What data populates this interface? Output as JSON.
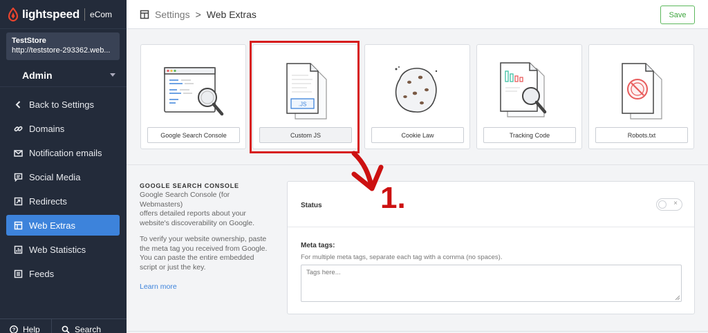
{
  "brand": {
    "name": "lightspeed",
    "product": "eCom"
  },
  "store": {
    "name": "TestStore",
    "url": "http://teststore-293362.web..."
  },
  "user_menu": {
    "label": "Admin"
  },
  "nav": [
    {
      "label": "Back to Settings",
      "icon": "chevron-left-icon",
      "active": false
    },
    {
      "label": "Domains",
      "icon": "link-icon",
      "active": false
    },
    {
      "label": "Notification emails",
      "icon": "email-icon",
      "active": false
    },
    {
      "label": "Social Media",
      "icon": "chat-icon",
      "active": false
    },
    {
      "label": "Redirects",
      "icon": "redirect-icon",
      "active": false
    },
    {
      "label": "Web Extras",
      "icon": "web-extras-icon",
      "active": true
    },
    {
      "label": "Web Statistics",
      "icon": "statistics-icon",
      "active": false
    },
    {
      "label": "Feeds",
      "icon": "feeds-icon",
      "active": false
    }
  ],
  "footer": {
    "help": "Help",
    "search": "Search"
  },
  "breadcrumb": {
    "parent": "Settings",
    "separator": ">",
    "current": "Web Extras"
  },
  "toolbar": {
    "save_label": "Save"
  },
  "tiles": [
    {
      "label": "Google Search Console"
    },
    {
      "label": "Custom JS",
      "art_text": ".JS"
    },
    {
      "label": "Cookie Law"
    },
    {
      "label": "Tracking Code"
    },
    {
      "label": "Robots.txt"
    }
  ],
  "section": {
    "title": "GOOGLE SEARCH CONSOLE",
    "lines1": [
      "Google Search Console (for Webmasters)",
      "offers detailed reports about your",
      "website's discoverability on Google."
    ],
    "lines2": [
      "To verify your website ownership, paste",
      "the meta tag you received from Google.",
      "You can paste the entire embedded",
      "script or just the key."
    ],
    "learn_more": "Learn more"
  },
  "panel": {
    "status_label": "Status",
    "toggle_x": "×",
    "meta_label": "Meta tags:",
    "meta_help": "For multiple meta tags, separate each tag with a comma (no spaces).",
    "meta_placeholder": "Tags here..."
  },
  "annotation": {
    "number": "1."
  },
  "colors": {
    "sidebar": "#232b3a",
    "accent": "#3d83db",
    "save": "#5cb85c",
    "annotation": "#d71c1c"
  }
}
